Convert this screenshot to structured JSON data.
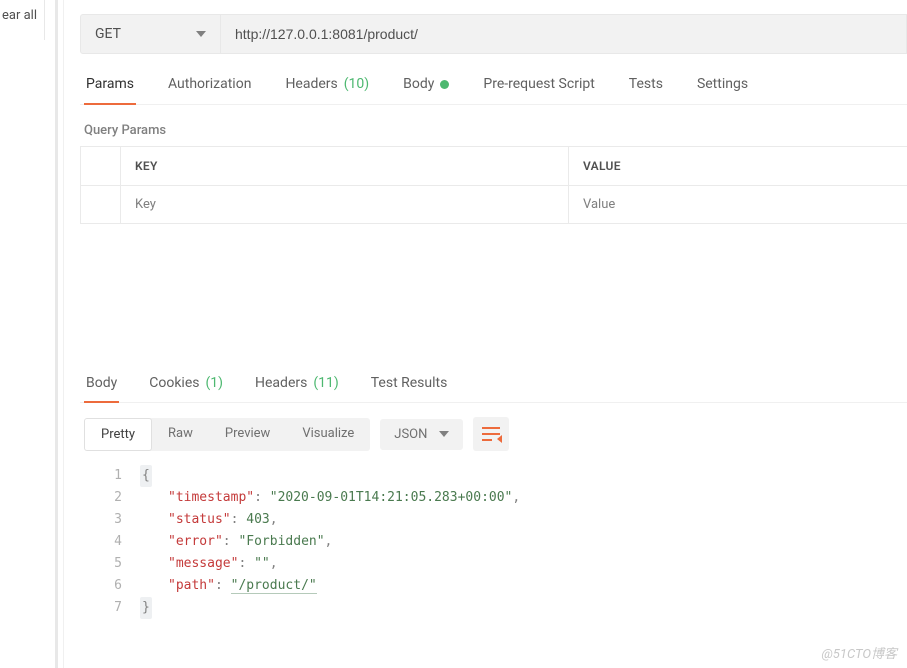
{
  "left": {
    "clear_all": "ear all"
  },
  "request": {
    "method": "GET",
    "url": "http://127.0.0.1:8081/product/",
    "tabs": {
      "params": "Params",
      "authorization": "Authorization",
      "headers": "Headers",
      "headers_count": "(10)",
      "body": "Body",
      "prerequest": "Pre-request Script",
      "tests": "Tests",
      "settings": "Settings"
    },
    "query_params_label": "Query Params",
    "qp_header_key": "KEY",
    "qp_header_value": "VALUE",
    "qp_key_placeholder": "Key",
    "qp_value_placeholder": "Value"
  },
  "response": {
    "tabs": {
      "body": "Body",
      "cookies": "Cookies",
      "cookies_count": "(1)",
      "headers": "Headers",
      "headers_count": "(11)",
      "test_results": "Test Results"
    },
    "view_modes": {
      "pretty": "Pretty",
      "raw": "Raw",
      "preview": "Preview",
      "visualize": "Visualize"
    },
    "format": "JSON",
    "body_json": {
      "timestamp": "2020-09-01T14:21:05.283+00:00",
      "status": 403,
      "error": "Forbidden",
      "message": "",
      "path": "/product/"
    },
    "lines": {
      "l1_open": "{",
      "l2_k": "\"timestamp\"",
      "l2_c": ": ",
      "l2_v": "\"2020-09-01T14:21:05.283+00:00\"",
      "l2_p": ",",
      "l3_k": "\"status\"",
      "l3_c": ": ",
      "l3_v": "403",
      "l3_p": ",",
      "l4_k": "\"error\"",
      "l4_c": ": ",
      "l4_v": "\"Forbidden\"",
      "l4_p": ",",
      "l5_k": "\"message\"",
      "l5_c": ": ",
      "l5_v": "\"\"",
      "l5_p": ",",
      "l6_k": "\"path\"",
      "l6_c": ": ",
      "l6_v": "\"/product/\"",
      "l7_close": "}"
    }
  },
  "watermark": "@51CTO博客"
}
